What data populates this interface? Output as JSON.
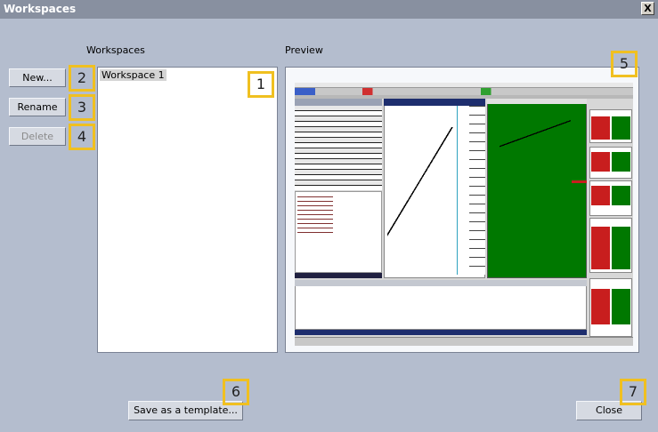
{
  "window": {
    "title": "Workspaces",
    "close_glyph": "X"
  },
  "labels": {
    "workspaces": "Workspaces",
    "preview": "Preview"
  },
  "buttons": {
    "new": "New...",
    "rename": "Rename",
    "delete": "Delete",
    "save_template": "Save as a template...",
    "close": "Close"
  },
  "workspace_list": [
    {
      "name": "Workspace 1",
      "selected": true
    }
  ],
  "callouts": [
    "1",
    "2",
    "3",
    "4",
    "5",
    "6",
    "7"
  ],
  "colors": {
    "callout_border": "#f0c020",
    "chart_green": "#007800",
    "tile_red": "#c81e1e"
  }
}
